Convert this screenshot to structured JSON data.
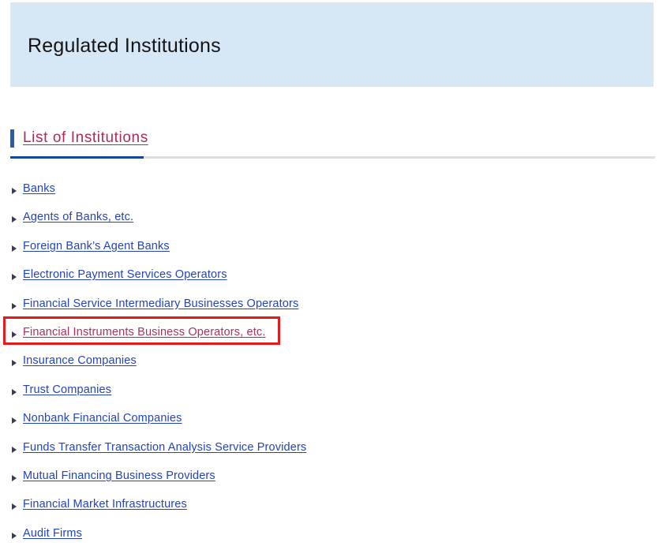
{
  "banner": {
    "title": "Regulated Institutions",
    "background_color": "#d6e7f5"
  },
  "section": {
    "heading": "List of Institutions",
    "heading_color": "#ac2a5e",
    "accent_bar_color": "#2a5caa",
    "rule_accent_color": "#13479b",
    "rule_color": "#dedede"
  },
  "list": {
    "bullet_icon": "triangle-right-icon",
    "link_color": "#2244bb",
    "visited_link_color": "#a8325e",
    "items": [
      {
        "label": "Banks",
        "visited": false
      },
      {
        "label": "Agents of Banks, etc.",
        "visited": false
      },
      {
        "label": "Foreign Bank’s Agent Banks",
        "visited": false
      },
      {
        "label": "Electronic Payment Services Operators",
        "visited": false
      },
      {
        "label": "Financial Service Intermediary Businesses Operators",
        "visited": false
      },
      {
        "label": "Financial Instruments Business Operators, etc.",
        "visited": true
      },
      {
        "label": "Insurance Companies",
        "visited": false
      },
      {
        "label": "Trust Companies",
        "visited": false
      },
      {
        "label": "Nonbank Financial Companies",
        "visited": false
      },
      {
        "label": "Funds Transfer Transaction Analysis Service Providers",
        "visited": false
      },
      {
        "label": "Mutual Financing Business Providers",
        "visited": false
      },
      {
        "label": "Financial Market Infrastructures",
        "visited": false
      },
      {
        "label": "Audit Firms",
        "visited": false
      }
    ]
  },
  "annotation": {
    "target_label": "Financial Instruments Business Operators, etc.",
    "border_color": "#e51b1b"
  }
}
